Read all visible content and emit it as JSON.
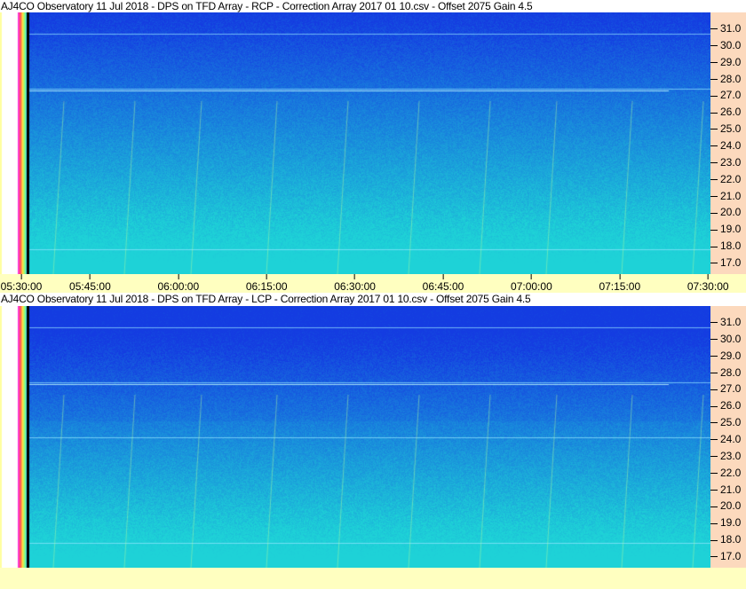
{
  "panels": [
    {
      "title": "AJ4CO Observatory 11 Jul 2018  -  DPS on TFD Array  -  RCP  -  Correction Array 2017 01 10.csv  -  Offset 2075  Gain 4.5",
      "polarization": "RCP"
    },
    {
      "title": "AJ4CO Observatory 11 Jul 2018  -  DPS on TFD Array  -  LCP  -  Correction Array 2017 01 10.csv  -  Offset 2075  Gain 4.5",
      "polarization": "LCP"
    }
  ],
  "y_ticks": [
    "31.0",
    "30.0",
    "29.0",
    "28.0",
    "27.0",
    "26.0",
    "25.0",
    "24.0",
    "23.0",
    "22.0",
    "21.0",
    "20.0",
    "19.0",
    "18.0",
    "17.0"
  ],
  "x_ticks": [
    "05:30:00",
    "05:45:00",
    "06:00:00",
    "06:15:00",
    "06:30:00",
    "06:45:00",
    "07:00:00",
    "07:15:00",
    "07:30:00"
  ],
  "colors": {
    "axis_bg": "#fcd9bd",
    "time_bg": "#ffffc0",
    "high_freq": "#1f4fe0",
    "low_freq": "#19c8e0"
  }
}
